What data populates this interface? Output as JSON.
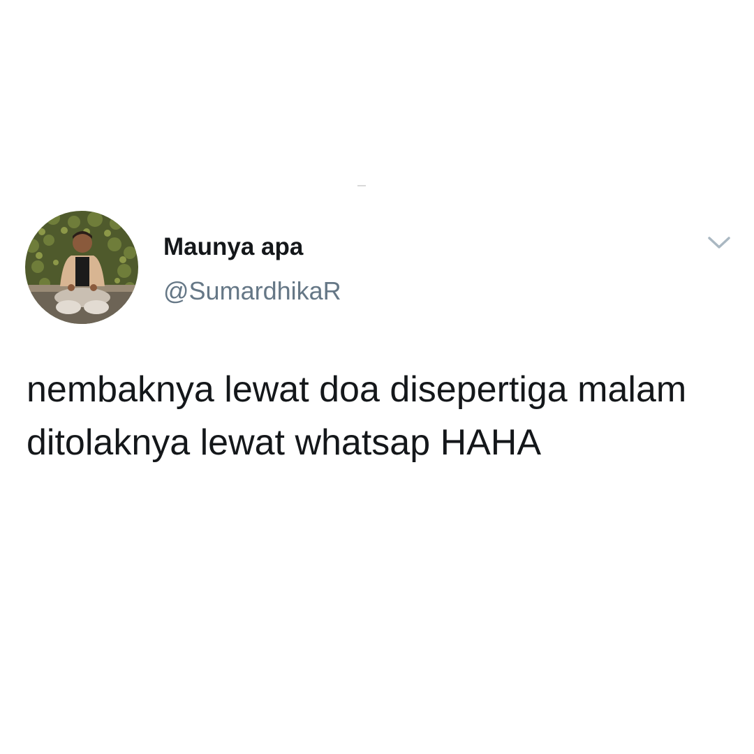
{
  "tweet": {
    "display_name": "Maunya apa",
    "handle": "@SumardhikaR",
    "text": "nembaknya lewat doa disepertiga malam ditolaknya lewat whatsap HAHA",
    "avatar_icon": "profile-photo-avatar",
    "menu_icon": "chevron-down-icon"
  },
  "colors": {
    "name": "#14171a",
    "handle": "#657786",
    "chevron": "#aab8c2",
    "background": "#ffffff"
  }
}
